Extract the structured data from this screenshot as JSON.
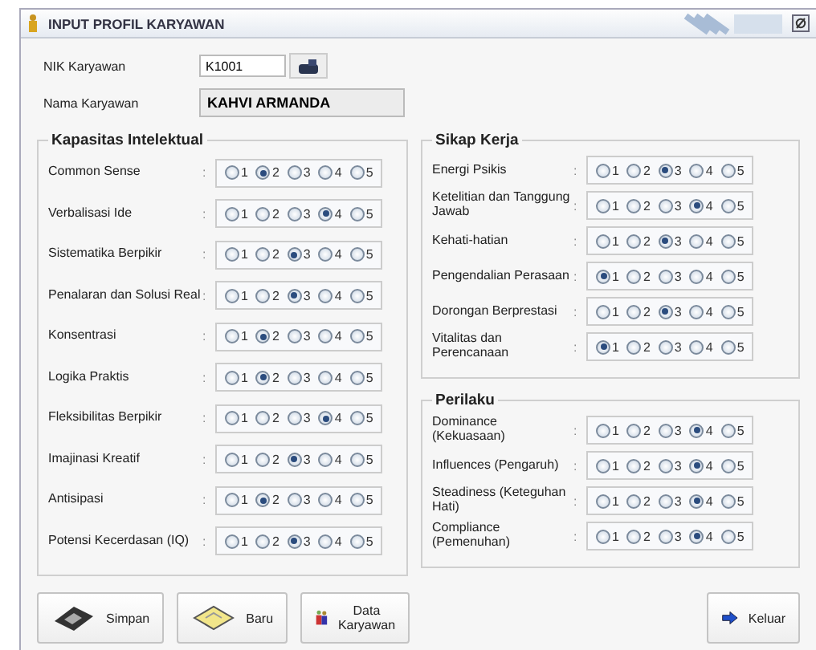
{
  "window": {
    "title": "INPUT PROFIL KARYAWAN"
  },
  "fields": [
    {
      "label": "NIK Karyawan",
      "value": "K1001",
      "kind": "lookup"
    },
    {
      "label": "Nama Karyawan",
      "value": "KAHVI ARMANDA",
      "kind": "readonly"
    }
  ],
  "groups": [
    {
      "title": "Kapasitas Intelektual",
      "rows": [
        {
          "label": "Common Sense",
          "colon": ":",
          "options": [
            {
              "label": "1",
              "selected": false
            },
            {
              "label": "2",
              "selected": true
            },
            {
              "label": "3",
              "selected": false
            },
            {
              "label": "4",
              "selected": false
            },
            {
              "label": "5",
              "selected": false
            }
          ]
        },
        {
          "label": "Verbalisasi Ide",
          "colon": ":",
          "options": [
            {
              "label": "1",
              "selected": false
            },
            {
              "label": "2",
              "selected": false
            },
            {
              "label": "3",
              "selected": false
            },
            {
              "label": "4",
              "selected": true
            },
            {
              "label": "5",
              "selected": false
            }
          ]
        },
        {
          "label": "Sistematika Berpikir",
          "colon": ":",
          "options": [
            {
              "label": "1",
              "selected": false
            },
            {
              "label": "2",
              "selected": false
            },
            {
              "label": "3",
              "selected": true
            },
            {
              "label": "4",
              "selected": false
            },
            {
              "label": "5",
              "selected": false
            }
          ]
        },
        {
          "label": "Penalaran dan Solusi Real",
          "colon": ":",
          "options": [
            {
              "label": "1",
              "selected": false
            },
            {
              "label": "2",
              "selected": false
            },
            {
              "label": "3",
              "selected": true
            },
            {
              "label": "4",
              "selected": false
            },
            {
              "label": "5",
              "selected": false
            }
          ]
        },
        {
          "label": "Konsentrasi",
          "colon": ":",
          "options": [
            {
              "label": "1",
              "selected": false
            },
            {
              "label": "2",
              "selected": true
            },
            {
              "label": "3",
              "selected": false
            },
            {
              "label": "4",
              "selected": false
            },
            {
              "label": "5",
              "selected": false
            }
          ]
        },
        {
          "label": "Logika Praktis",
          "colon": ":",
          "options": [
            {
              "label": "1",
              "selected": false
            },
            {
              "label": "2",
              "selected": true
            },
            {
              "label": "3",
              "selected": false
            },
            {
              "label": "4",
              "selected": false
            },
            {
              "label": "5",
              "selected": false
            }
          ]
        },
        {
          "label": "Fleksibilitas Berpikir",
          "colon": ":",
          "options": [
            {
              "label": "1",
              "selected": false
            },
            {
              "label": "2",
              "selected": false
            },
            {
              "label": "3",
              "selected": false
            },
            {
              "label": "4",
              "selected": true
            },
            {
              "label": "5",
              "selected": false
            }
          ]
        },
        {
          "label": "Imajinasi Kreatif",
          "colon": ":",
          "options": [
            {
              "label": "1",
              "selected": false
            },
            {
              "label": "2",
              "selected": false
            },
            {
              "label": "3",
              "selected": true
            },
            {
              "label": "4",
              "selected": false
            },
            {
              "label": "5",
              "selected": false
            }
          ]
        },
        {
          "label": "Antisipasi",
          "colon": ":",
          "options": [
            {
              "label": "1",
              "selected": false
            },
            {
              "label": "2",
              "selected": true
            },
            {
              "label": "3",
              "selected": false
            },
            {
              "label": "4",
              "selected": false
            },
            {
              "label": "5",
              "selected": false
            }
          ]
        },
        {
          "label": "Potensi Kecerdasan (IQ)",
          "colon": ":",
          "options": [
            {
              "label": "1",
              "selected": false
            },
            {
              "label": "2",
              "selected": false
            },
            {
              "label": "3",
              "selected": true
            },
            {
              "label": "4",
              "selected": false
            },
            {
              "label": "5",
              "selected": false
            }
          ]
        }
      ]
    },
    {
      "title": "Sikap Kerja",
      "rows": [
        {
          "label": "Energi Psikis",
          "colon": ":",
          "options": [
            {
              "label": "1",
              "selected": false
            },
            {
              "label": "2",
              "selected": false
            },
            {
              "label": "3",
              "selected": true
            },
            {
              "label": "4",
              "selected": false
            },
            {
              "label": "5",
              "selected": false
            }
          ]
        },
        {
          "label": "Ketelitian dan Tanggung Jawab",
          "colon": ":",
          "options": [
            {
              "label": "1",
              "selected": false
            },
            {
              "label": "2",
              "selected": false
            },
            {
              "label": "3",
              "selected": false
            },
            {
              "label": "4",
              "selected": true
            },
            {
              "label": "5",
              "selected": false
            }
          ]
        },
        {
          "label": "Kehati-hatian",
          "colon": ":",
          "options": [
            {
              "label": "1",
              "selected": false
            },
            {
              "label": "2",
              "selected": false
            },
            {
              "label": "3",
              "selected": true
            },
            {
              "label": "4",
              "selected": false
            },
            {
              "label": "5",
              "selected": false
            }
          ]
        },
        {
          "label": "Pengendalian Perasaan",
          "colon": ":",
          "options": [
            {
              "label": "1",
              "selected": true
            },
            {
              "label": "2",
              "selected": false
            },
            {
              "label": "3",
              "selected": false
            },
            {
              "label": "4",
              "selected": false
            },
            {
              "label": "5",
              "selected": false
            }
          ]
        },
        {
          "label": "Dorongan Berprestasi",
          "colon": ":",
          "options": [
            {
              "label": "1",
              "selected": false
            },
            {
              "label": "2",
              "selected": false
            },
            {
              "label": "3",
              "selected": true
            },
            {
              "label": "4",
              "selected": false
            },
            {
              "label": "5",
              "selected": false
            }
          ]
        },
        {
          "label": "Vitalitas dan Perencanaan",
          "colon": ":",
          "options": [
            {
              "label": "1",
              "selected": true
            },
            {
              "label": "2",
              "selected": false
            },
            {
              "label": "3",
              "selected": false
            },
            {
              "label": "4",
              "selected": false
            },
            {
              "label": "5",
              "selected": false
            }
          ]
        }
      ]
    },
    {
      "title": "Perilaku",
      "rows": [
        {
          "label": "Dominance (Kekuasaan)",
          "colon": ":",
          "options": [
            {
              "label": "1",
              "selected": false
            },
            {
              "label": "2",
              "selected": false
            },
            {
              "label": "3",
              "selected": false
            },
            {
              "label": "4",
              "selected": true
            },
            {
              "label": "5",
              "selected": false
            }
          ]
        },
        {
          "label": "Influences (Pengaruh)",
          "colon": ":",
          "options": [
            {
              "label": "1",
              "selected": false
            },
            {
              "label": "2",
              "selected": false
            },
            {
              "label": "3",
              "selected": false
            },
            {
              "label": "4",
              "selected": true
            },
            {
              "label": "5",
              "selected": false
            }
          ]
        },
        {
          "label": "Steadiness (Keteguhan Hati)",
          "colon": ":",
          "options": [
            {
              "label": "1",
              "selected": false
            },
            {
              "label": "2",
              "selected": false
            },
            {
              "label": "3",
              "selected": false
            },
            {
              "label": "4",
              "selected": true
            },
            {
              "label": "5",
              "selected": false
            }
          ]
        },
        {
          "label": "Compliance (Pemenuhan)",
          "colon": ":",
          "options": [
            {
              "label": "1",
              "selected": false
            },
            {
              "label": "2",
              "selected": false
            },
            {
              "label": "3",
              "selected": false
            },
            {
              "label": "4",
              "selected": true
            },
            {
              "label": "5",
              "selected": false
            }
          ]
        }
      ]
    }
  ],
  "buttons": [
    {
      "label": "Simpan",
      "kind": "save"
    },
    {
      "label": "Baru",
      "kind": "new"
    },
    {
      "label": "Data Karyawan",
      "kind": "data"
    },
    {
      "label": "Keluar",
      "kind": "exit"
    }
  ]
}
